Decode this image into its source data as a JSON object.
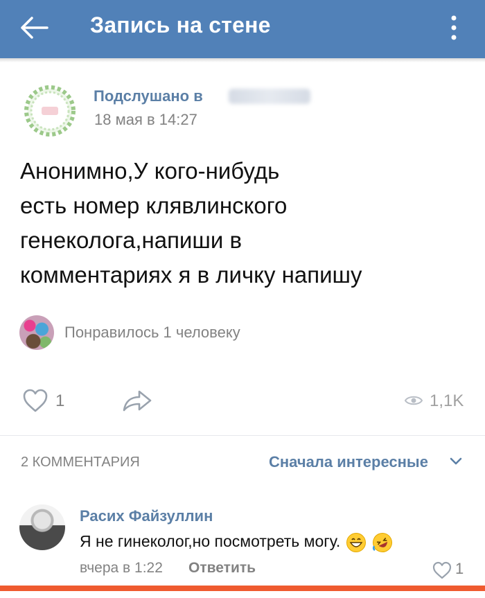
{
  "header": {
    "title": "Запись на стене",
    "bg_color": "#5181b8",
    "back_icon": "arrow-left-icon",
    "menu_icon": "dots-vertical-icon"
  },
  "post": {
    "group_name": "Подслушано в",
    "date": "18 мая в 14:27",
    "text_lines": [
      "Анонимно,У кого-нибудь",
      "есть номер клявлинского",
      "генеколога,напиши в",
      "комментариях я в личку напишу"
    ],
    "liked_by": "Понравилось 1 человеку",
    "likes_count": "1",
    "views": "1,1K"
  },
  "comments": {
    "count_label": "2 КОММЕНТАРИЯ",
    "sort_label": "Сначала интересные",
    "items": [
      {
        "author": "Расих Файзуллин",
        "text": "Я не гинеколог,но посмотреть могу.",
        "time": "вчера в 1:22",
        "reply_label": "Ответить",
        "likes": "1"
      }
    ]
  },
  "colors": {
    "link": "#5b7fa6",
    "secondary": "#828282",
    "accent_bar": "#ef5a2f"
  }
}
